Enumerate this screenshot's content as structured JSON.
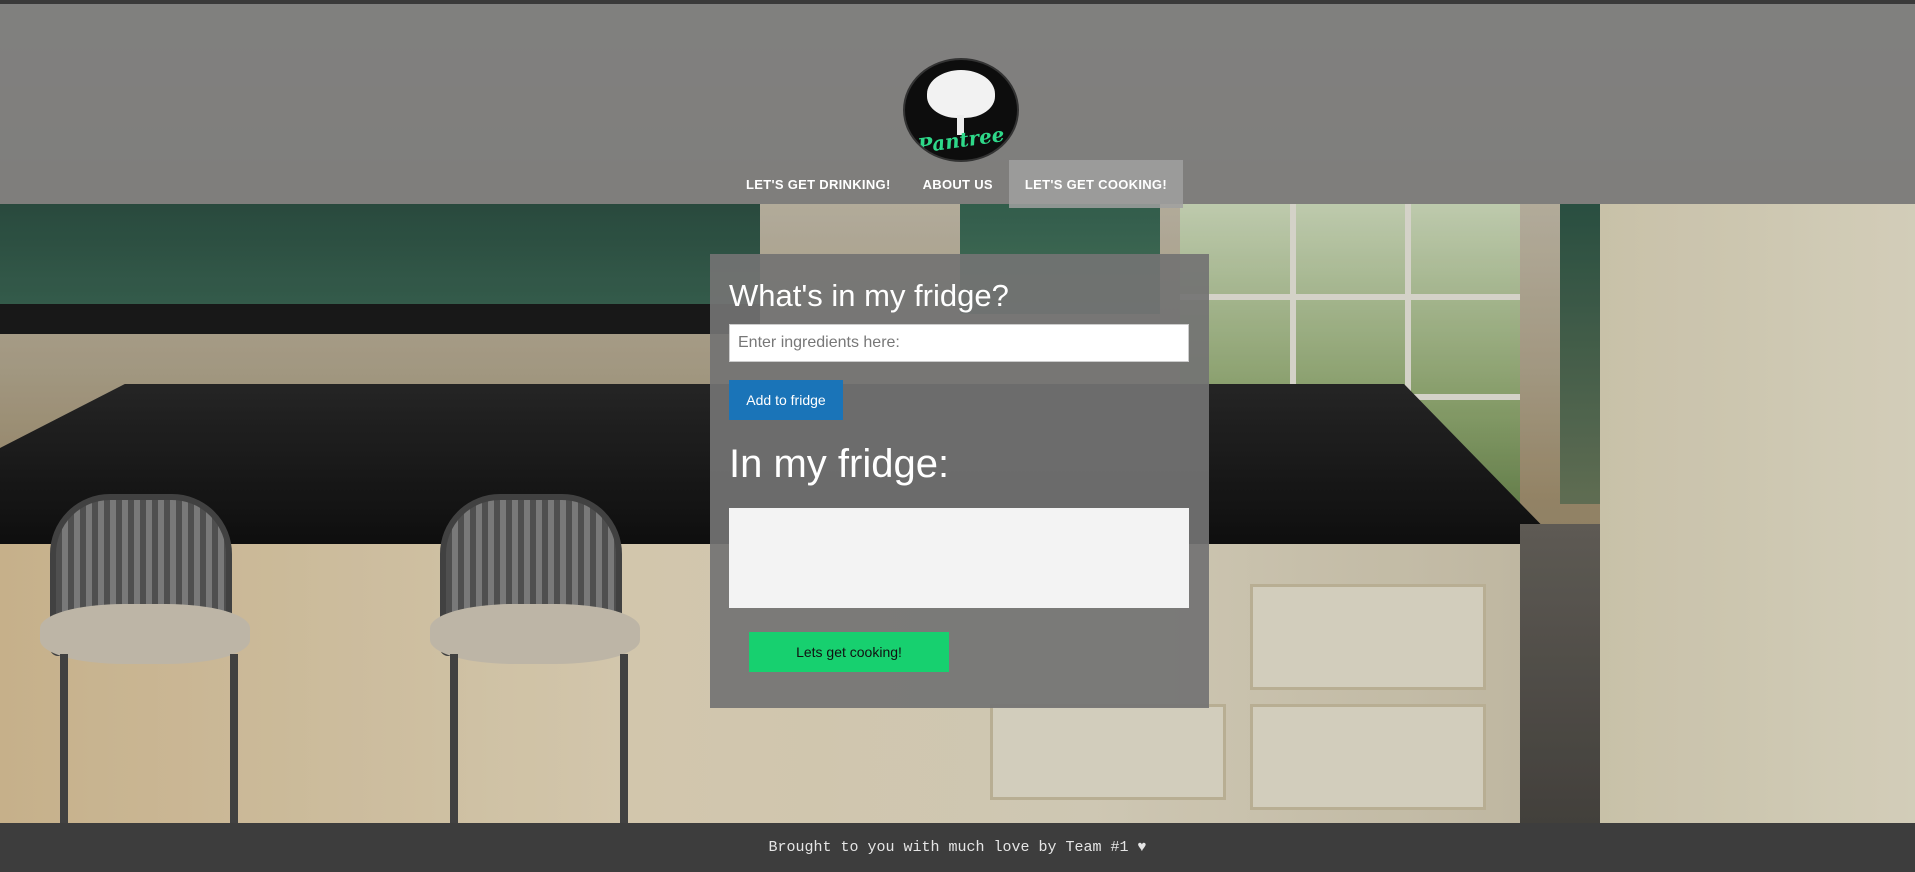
{
  "header": {
    "logo_text": "Pantree",
    "nav": [
      {
        "label": "LET'S GET DRINKING!"
      },
      {
        "label": "ABOUT US"
      },
      {
        "label": "LET'S GET COOKING!",
        "active": true
      }
    ]
  },
  "main": {
    "title": "What's in my fridge?",
    "input": {
      "placeholder": "Enter ingredients here:",
      "value": ""
    },
    "add_button": "Add to fridge",
    "fridge_heading": "In my fridge:",
    "fridge_items": [],
    "cook_button": "Lets get cooking!"
  },
  "footer": {
    "text": "Brought to you with much love by Team #1 ♥"
  },
  "colors": {
    "add_button": "#1a74b8",
    "cook_button": "#17d06f",
    "logo_text": "#2ed889"
  }
}
